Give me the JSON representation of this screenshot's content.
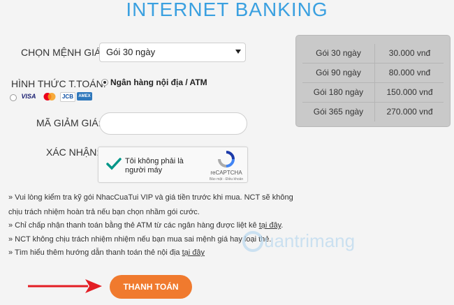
{
  "page_title": "INTERNET BANKING",
  "form": {
    "package_label": "CHỌN MỆNH GIÁ:",
    "package_selected": "Gói 30 ngày",
    "payment_label": "HÌNH THỨC T.TOÁN:",
    "payment_option_domestic": "Ngân hàng nội địa / ATM",
    "card_logos": [
      "VISA",
      "MC",
      "JCB",
      "AMEX"
    ],
    "discount_label": "MÃ GIẢM GIÁ:",
    "discount_value": "",
    "confirm_label": "XÁC NHẬN:"
  },
  "captcha": {
    "checkbox_text": "Tôi không phải là người máy",
    "brand": "reCAPTCHA",
    "terms": "Bảo mật - Điều khoản"
  },
  "price_table": [
    {
      "name": "Gói 30 ngày",
      "price": "30.000 vnđ"
    },
    {
      "name": "Gói 90 ngày",
      "price": "80.000 vnđ"
    },
    {
      "name": "Gói 180 ngày",
      "price": "150.000 vnđ"
    },
    {
      "name": "Gói 365 ngày",
      "price": "270.000 vnđ"
    }
  ],
  "notes": {
    "line1a": "» Vui lòng kiểm tra kỹ gói NhacCuaTui VIP và giá tiền trước khi mua. NCT sẽ không",
    "line1b": "chịu trách nhiệm hoàn trả nếu bạn chọn nhầm gói cước.",
    "line2": "» Chỉ chấp nhận thanh toán bằng thẻ ATM từ các ngân hàng được liệt kê ",
    "line2_link": "tại đây",
    "line2_end": ".",
    "line3": "» NCT không chịu trách nhiệm nhiệm nếu bạn mua sai mệnh giá hay loại thẻ.",
    "line4": "» Tìm hiểu thêm hướng dẫn thanh toán thẻ nội địa ",
    "line4_link": "tại đây"
  },
  "pay_button": "THANH TOÁN",
  "watermark": "Quantrimang",
  "colors": {
    "title": "#3aa0e0",
    "button": "#f07a2e",
    "arrow": "#e31e24",
    "check": "#009688"
  }
}
